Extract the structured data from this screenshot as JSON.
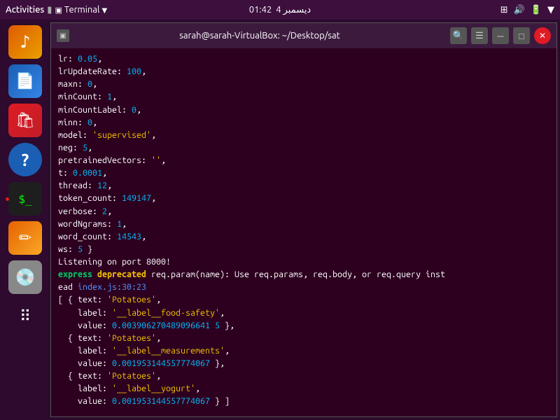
{
  "topbar": {
    "activities": "Activities",
    "terminal_label": "Terminal",
    "time": "01:42",
    "date": "4 دیسمبر"
  },
  "titlebar": {
    "title": "sarah@sarah-VirtualBox: ~/Desktop/sat"
  },
  "terminal": {
    "lines": [
      {
        "text": "lr: 0.05,",
        "type": "plain"
      },
      {
        "text": "lrUpdateRate: 100,",
        "type": "plain"
      },
      {
        "text": "maxn: 0,",
        "type": "plain"
      },
      {
        "text": "minCount: 1,",
        "type": "plain"
      },
      {
        "text": "minCountLabel: 0,",
        "type": "plain"
      },
      {
        "text": "minn: 0,",
        "type": "plain"
      },
      {
        "text": "model: 'supervised',",
        "type": "model"
      },
      {
        "text": "neg: 5,",
        "type": "plain"
      },
      {
        "text": "pretrainedVectors: '',",
        "type": "plain"
      },
      {
        "text": "t: 0.0001,",
        "type": "plain"
      },
      {
        "text": "thread: 12,",
        "type": "plain"
      },
      {
        "text": "token_count: 149147,",
        "type": "plain"
      },
      {
        "text": "verbose: 2,",
        "type": "plain"
      },
      {
        "text": "wordNgrams: 1,",
        "type": "plain"
      },
      {
        "text": "word_count: 14543,",
        "type": "plain"
      },
      {
        "text": "ws: 5 }",
        "type": "plain"
      },
      {
        "text": "Listening on port 8000!",
        "type": "listen"
      },
      {
        "text": "express deprecated req.param(name): Use req.params, req.body, or req.query inst",
        "type": "deprecated"
      },
      {
        "text": "ead index.js:30:23",
        "type": "deprecated2"
      },
      {
        "text": "[ { text: 'Potatoes',",
        "type": "result"
      },
      {
        "text": "    label: '__label__food-safety',",
        "type": "result"
      },
      {
        "text": "    value: 0.003906270489096641 5 },",
        "type": "value"
      },
      {
        "text": "  { text: 'Potatoes',",
        "type": "result"
      },
      {
        "text": "    label: '__label__measurements',",
        "type": "result"
      },
      {
        "text": "    value: 0.001953144557774067 },",
        "type": "value"
      },
      {
        "text": "  { text: 'Potatoes',",
        "type": "result"
      },
      {
        "text": "    label: '__label__yogurt',",
        "type": "result"
      },
      {
        "text": "    value: 0.001953144557774067 } ]",
        "type": "value"
      }
    ]
  }
}
